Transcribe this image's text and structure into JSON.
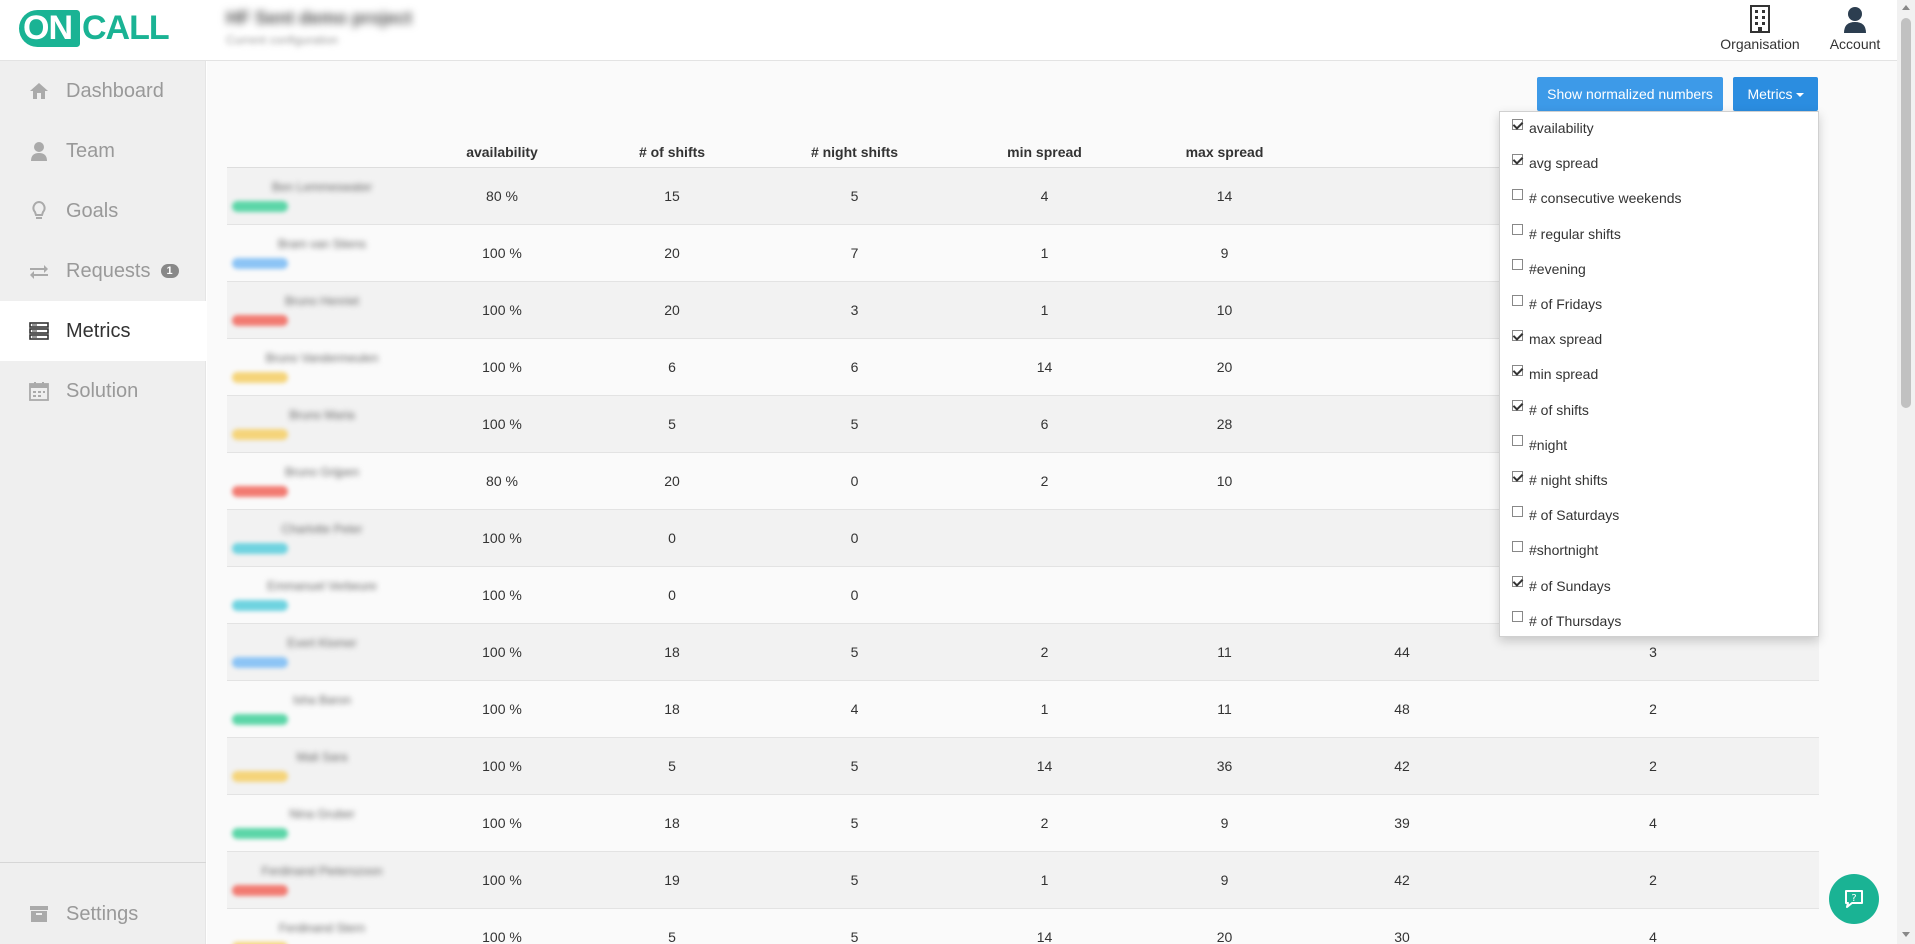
{
  "brand": {
    "part1": "ON",
    "part2": "CALL"
  },
  "project": {
    "title": "HF Sent demo project",
    "subtitle": "Current configuration"
  },
  "topnav": [
    {
      "label": "Organisation",
      "icon": "building-icon"
    },
    {
      "label": "Account",
      "icon": "user-icon"
    }
  ],
  "sidebar": {
    "items": [
      {
        "label": "Dashboard",
        "icon": "home-icon"
      },
      {
        "label": "Team",
        "icon": "user-icon"
      },
      {
        "label": "Goals",
        "icon": "lightbulb-icon"
      },
      {
        "label": "Requests",
        "icon": "exchange-icon",
        "badge": "1"
      },
      {
        "label": "Metrics",
        "icon": "server-icon",
        "active": true
      },
      {
        "label": "Solution",
        "icon": "calendar-icon"
      }
    ],
    "settings": {
      "label": "Settings",
      "icon": "archive-icon"
    }
  },
  "toolbar": {
    "normalize_label": "Show normalized numbers",
    "metrics_label": "Metrics"
  },
  "table": {
    "columns": [
      "availability",
      "# of shifts",
      "# night shifts",
      "min spread",
      "max spread",
      "",
      ""
    ],
    "rows": [
      {
        "name": "Ben Lemmeswater",
        "tag_color": "#5cd6a8",
        "values": [
          "80 %",
          "15",
          "5",
          "4",
          "14",
          "",
          ""
        ]
      },
      {
        "name": "Bram van Stiens",
        "tag_color": "#8cc4f5",
        "values": [
          "100 %",
          "20",
          "7",
          "1",
          "9",
          "",
          ""
        ]
      },
      {
        "name": "Bruno Henriet",
        "tag_color": "#f27b72",
        "values": [
          "100 %",
          "20",
          "3",
          "1",
          "10",
          "",
          ""
        ]
      },
      {
        "name": "Bruno Vandermeulen",
        "tag_color": "#f5d47a",
        "values": [
          "100 %",
          "6",
          "6",
          "14",
          "20",
          "",
          ""
        ]
      },
      {
        "name": "Bruno Maria",
        "tag_color": "#f5d47a",
        "values": [
          "100 %",
          "5",
          "5",
          "6",
          "28",
          "",
          ""
        ]
      },
      {
        "name": "Bruno Grijpen",
        "tag_color": "#f27b72",
        "values": [
          "80 %",
          "20",
          "0",
          "2",
          "10",
          "",
          ""
        ]
      },
      {
        "name": "Charlotte Peter",
        "tag_color": "#6fd3e0",
        "values": [
          "100 %",
          "0",
          "0",
          "",
          "",
          "",
          ""
        ]
      },
      {
        "name": "Emmanuel Verbeure",
        "tag_color": "#6fd3e0",
        "values": [
          "100 %",
          "0",
          "0",
          "",
          "",
          "",
          ""
        ]
      },
      {
        "name": "Evert Klomer",
        "tag_color": "#8cc4f5",
        "values": [
          "100 %",
          "18",
          "5",
          "2",
          "11",
          "44",
          "3"
        ]
      },
      {
        "name": "Isha Baron",
        "tag_color": "#5cd6a8",
        "values": [
          "100 %",
          "18",
          "4",
          "1",
          "11",
          "48",
          "2"
        ]
      },
      {
        "name": "Mali Sara",
        "tag_color": "#f5d47a",
        "values": [
          "100 %",
          "5",
          "5",
          "14",
          "36",
          "42",
          "2"
        ]
      },
      {
        "name": "Nina Gruber",
        "tag_color": "#5cd6a8",
        "values": [
          "100 %",
          "18",
          "5",
          "2",
          "9",
          "39",
          "4"
        ]
      },
      {
        "name": "Ferdinand Pieterszoon",
        "tag_color": "#f27b72",
        "values": [
          "100 %",
          "19",
          "5",
          "1",
          "9",
          "42",
          "2"
        ]
      },
      {
        "name": "Ferdinand Stern",
        "tag_color": "#f5d47a",
        "values": [
          "100 %",
          "5",
          "5",
          "14",
          "20",
          "30",
          "4"
        ]
      }
    ]
  },
  "dropdown": {
    "items": [
      {
        "label": "availability",
        "checked": true
      },
      {
        "label": "avg spread",
        "checked": true
      },
      {
        "label": "# consecutive weekends",
        "checked": false
      },
      {
        "label": "# regular shifts",
        "checked": false
      },
      {
        "label": "#evening",
        "checked": false
      },
      {
        "label": "# of Fridays",
        "checked": false
      },
      {
        "label": "max spread",
        "checked": true
      },
      {
        "label": "min spread",
        "checked": true
      },
      {
        "label": "# of shifts",
        "checked": true
      },
      {
        "label": "#night",
        "checked": false
      },
      {
        "label": "# night shifts",
        "checked": true
      },
      {
        "label": "# of Saturdays",
        "checked": false
      },
      {
        "label": "#shortnight",
        "checked": false
      },
      {
        "label": "# of Sundays",
        "checked": true
      },
      {
        "label": "# of Thursdays",
        "checked": false
      }
    ]
  },
  "colors": {
    "brand": "#1ab394",
    "button": "#3d9ae8",
    "sidebar_bg": "#efefef"
  }
}
